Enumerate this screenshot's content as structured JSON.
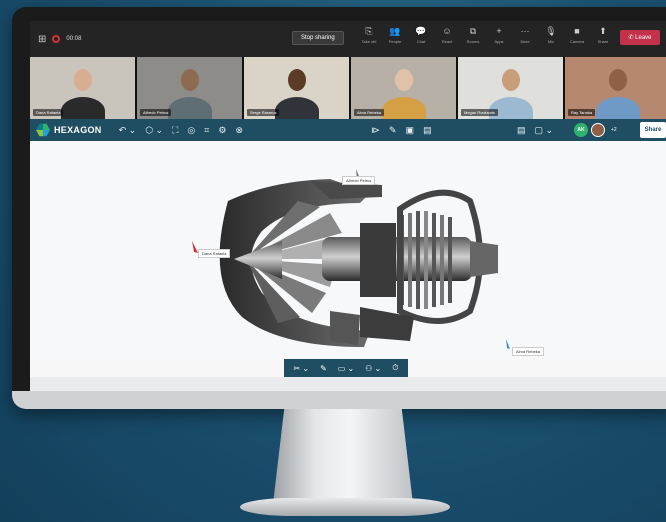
{
  "teams": {
    "timer": "00:08",
    "stop_sharing": "Stop sharing",
    "actions": [
      {
        "label": "Take ctrl",
        "icon": "take-control-icon",
        "glyph": "⎘"
      },
      {
        "label": "People",
        "icon": "people-icon",
        "glyph": "👥"
      },
      {
        "label": "Chat",
        "icon": "chat-icon",
        "glyph": "💬"
      },
      {
        "label": "React",
        "icon": "react-icon",
        "glyph": "☺"
      },
      {
        "label": "Rooms",
        "icon": "rooms-icon",
        "glyph": "⧉"
      },
      {
        "label": "Apps",
        "icon": "apps-icon",
        "glyph": "+"
      },
      {
        "label": "More",
        "icon": "more-icon",
        "glyph": "···"
      },
      {
        "label": "Mic",
        "icon": "mic-icon",
        "glyph": "🎙"
      },
      {
        "label": "Camera",
        "icon": "camera-icon",
        "glyph": "■"
      },
      {
        "label": "Share",
        "icon": "share-icon",
        "glyph": "⬆"
      }
    ],
    "leave": "Leave"
  },
  "participants": [
    {
      "name": "Dana Rafaela",
      "bg": "#c9c4bc",
      "skin": "#d8ae92",
      "shirt": "#2a2a2a"
    },
    {
      "name": "Alfredo Petrus",
      "bg": "#8d8c88",
      "skin": "#8e6a52",
      "shirt": "#5f6e73"
    },
    {
      "name": "Serge Rasmus",
      "bg": "#d9d3c8",
      "skin": "#5b3a28",
      "shirt": "#30343a"
    },
    {
      "name": "Alma Rebeka",
      "bg": "#b7b0a6",
      "skin": "#e2c1a9",
      "shirt": "#d5a044"
    },
    {
      "name": "Megan Rowlands",
      "bg": "#dfe0dc",
      "skin": "#c89d7c",
      "shirt": "#9bbad2"
    },
    {
      "name": "Ray Tanaka",
      "bg": "#b78870",
      "skin": "#8f5f46",
      "shirt": "#6f9ac6"
    }
  ],
  "app": {
    "logo_text": "HEXAGON",
    "tools_left": [
      "↶ ⌄",
      "⬡ ⌄",
      "⛶",
      "◎",
      "⌗",
      "⚙",
      "⊗"
    ],
    "tools_mid": [
      "⧐",
      "✎",
      "▣",
      "▤"
    ],
    "tools_right": [
      "▤",
      "▢ ⌄"
    ],
    "avatar_initials": "AK",
    "plus_count": "+2",
    "share": "Share"
  },
  "canvas": {
    "labels": [
      {
        "text": "Alfredo Petrus",
        "name": "collaborator-label-alfredo"
      },
      {
        "text": "Dana Rafaela",
        "name": "collaborator-label-dana"
      },
      {
        "text": "Alma Rebeka",
        "name": "collaborator-label-alma"
      }
    ]
  },
  "bottom_tools": [
    "✂ ⌄",
    "✎",
    "▭ ⌄",
    "⚇ ⌄",
    "⏱"
  ],
  "colors": {
    "app_bar": "#1f4e63",
    "leave": "#c4314b",
    "teams_bar": "#242424"
  }
}
